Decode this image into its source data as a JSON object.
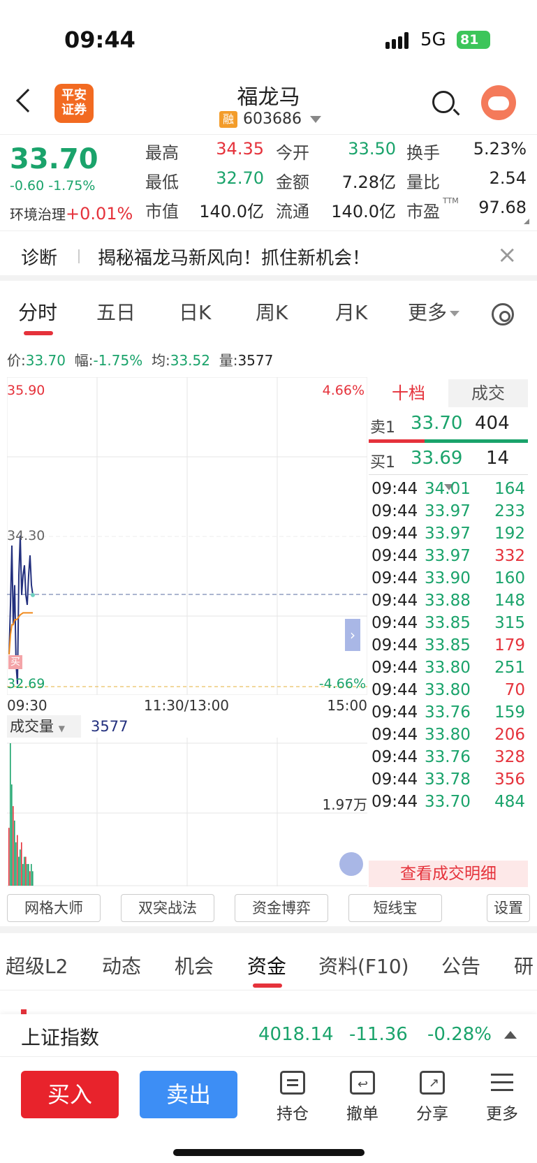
{
  "status": {
    "time": "09:44",
    "network": "5G",
    "battery": "81"
  },
  "header": {
    "broker_logo": "平安\n证券",
    "stock_name": "福龙马",
    "rong_badge": "融",
    "stock_code": "603686"
  },
  "quote": {
    "price": "33.70",
    "change": "-0.60",
    "change_pct": "-1.75%",
    "sector_name": "环境治理",
    "sector_change": "+0.01%",
    "fields": [
      {
        "label": "最高",
        "value": "34.35",
        "color": "red"
      },
      {
        "label": "今开",
        "value": "33.50",
        "color": "green"
      },
      {
        "label": "换手",
        "value": "5.23%",
        "color": "black"
      },
      {
        "label": "最低",
        "value": "32.70",
        "color": "green"
      },
      {
        "label": "金额",
        "value": "7.28亿",
        "color": "black"
      },
      {
        "label": "量比",
        "value": "2.54",
        "color": "black"
      },
      {
        "label": "市值",
        "value": "140.0亿",
        "color": "black"
      },
      {
        "label": "流通",
        "value": "140.0亿",
        "color": "black"
      },
      {
        "label": "市盈",
        "value": "97.68",
        "color": "black"
      }
    ],
    "ttm": "TTM"
  },
  "banner": {
    "tag": "诊断",
    "message": "揭秘福龙马新风向！抓住新机会！",
    "close": "×"
  },
  "tabs": [
    "分时",
    "五日",
    "日K",
    "周K",
    "月K",
    "更多"
  ],
  "info": {
    "price_label": "价:",
    "price": "33.70",
    "amp_label": "幅:",
    "amp": "-1.75%",
    "avg_label": "均:",
    "avg": "33.52",
    "vol_label": "量:",
    "vol": "3577"
  },
  "chart": {
    "top_price": "35.90",
    "top_pct": "4.66%",
    "mid_price": "34.30",
    "low_price": "32.69",
    "low_pct": "-4.66%",
    "x_start": "09:30",
    "x_mid": "11:30/13:00",
    "x_end": "15:00",
    "buy_marker": "买"
  },
  "chart_data": {
    "type": "line",
    "title": "",
    "ylim": [
      32.69,
      35.9
    ],
    "series": [
      {
        "values": [
          33.1,
          33.6,
          34.2,
          33.4,
          33.8,
          33.0,
          32.8,
          33.9,
          34.3,
          33.7,
          33.9,
          34.0,
          33.7,
          33.6,
          33.9,
          34.1,
          33.8,
          33.7
        ]
      },
      {
        "values": [
          33.1,
          33.3,
          33.4,
          33.4,
          33.45,
          33.45,
          33.46,
          33.48,
          33.5,
          33.51,
          33.52,
          33.52,
          33.52,
          33.52,
          33.52,
          33.52,
          33.52,
          33.52
        ]
      }
    ],
    "volume_label": "成交量",
    "volume_current": "3577",
    "volume_max": "1.97万",
    "volume": [
      8,
      19.7,
      14,
      11,
      9,
      6,
      7,
      4,
      5,
      6,
      3,
      4,
      4,
      3,
      3,
      2,
      3,
      2
    ]
  },
  "bidask": {
    "tab_on": "十档",
    "tab_off": "成交",
    "sell": {
      "label": "卖1",
      "price": "33.70",
      "qty": "404"
    },
    "buy": {
      "label": "买1",
      "price": "33.69",
      "qty": "14"
    },
    "trades": [
      {
        "t": "09:44",
        "p": "34.01",
        "q": "164",
        "c": "green"
      },
      {
        "t": "09:44",
        "p": "33.97",
        "q": "233",
        "c": "green"
      },
      {
        "t": "09:44",
        "p": "33.97",
        "q": "192",
        "c": "green"
      },
      {
        "t": "09:44",
        "p": "33.97",
        "q": "332",
        "c": "red"
      },
      {
        "t": "09:44",
        "p": "33.90",
        "q": "160",
        "c": "green"
      },
      {
        "t": "09:44",
        "p": "33.88",
        "q": "148",
        "c": "green"
      },
      {
        "t": "09:44",
        "p": "33.85",
        "q": "315",
        "c": "green"
      },
      {
        "t": "09:44",
        "p": "33.85",
        "q": "179",
        "c": "red"
      },
      {
        "t": "09:44",
        "p": "33.80",
        "q": "251",
        "c": "green"
      },
      {
        "t": "09:44",
        "p": "33.80",
        "q": "70",
        "c": "red"
      },
      {
        "t": "09:44",
        "p": "33.76",
        "q": "159",
        "c": "green"
      },
      {
        "t": "09:44",
        "p": "33.80",
        "q": "206",
        "c": "red"
      },
      {
        "t": "09:44",
        "p": "33.76",
        "q": "328",
        "c": "red"
      },
      {
        "t": "09:44",
        "p": "33.78",
        "q": "356",
        "c": "red"
      },
      {
        "t": "09:44",
        "p": "33.70",
        "q": "484",
        "c": "green"
      }
    ],
    "detail": "查看成交明细"
  },
  "tools": [
    "网格大师",
    "双突战法",
    "资金博弈",
    "短线宝",
    "设置"
  ],
  "subtabs": [
    "超级L2",
    "动态",
    "机会",
    "资金",
    "资料(F10)",
    "公告",
    "研"
  ],
  "index": {
    "name": "上证指数",
    "value": "4018.14",
    "change": "-11.36",
    "pct": "-0.28%"
  },
  "bottom": {
    "buy": "买入",
    "sell": "卖出",
    "hold": "持仓",
    "cancel": "撤单",
    "share": "分享",
    "more": "更多"
  },
  "colors": {
    "red": "#e5323b",
    "green": "#1aa36b",
    "blue_line": "#23307e",
    "avg_line": "#f08a1c"
  }
}
